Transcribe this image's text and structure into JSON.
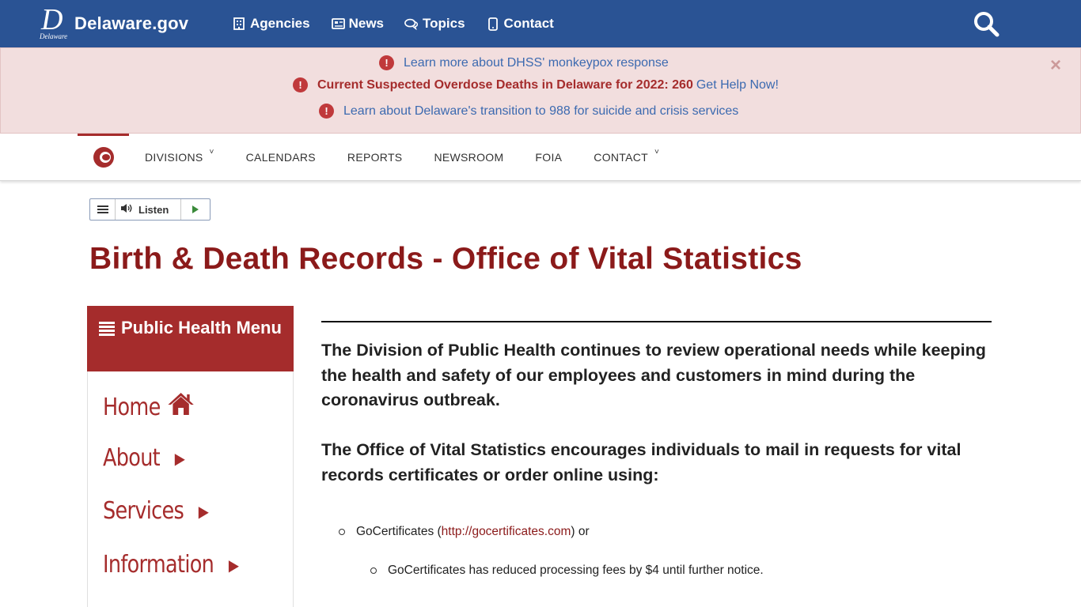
{
  "topbar": {
    "logo_text": "Delaware.gov",
    "logo_letter": "D",
    "logo_sub": "Delaware",
    "nav": [
      {
        "label": "Agencies",
        "icon": "building-icon"
      },
      {
        "label": "News",
        "icon": "newspaper-icon"
      },
      {
        "label": "Topics",
        "icon": "comments-icon"
      },
      {
        "label": "Contact",
        "icon": "phone-icon"
      }
    ],
    "search_icon": "search-icon"
  },
  "alerts": {
    "close_glyph": "×",
    "items": [
      {
        "bold": "",
        "link": "Learn more about DHSS' monkeypox response"
      },
      {
        "bold": "Current Suspected Overdose Deaths in Delaware for 2022: 260",
        "link": "Get Help Now!"
      },
      {
        "bold": "",
        "link": "Learn about Delaware's transition to 988 for suicide and crisis services"
      }
    ]
  },
  "division_nav": {
    "items": [
      {
        "label": "DIVISIONS",
        "has_caret": true
      },
      {
        "label": "CALENDARS",
        "has_caret": false
      },
      {
        "label": "REPORTS",
        "has_caret": false
      },
      {
        "label": "NEWSROOM",
        "has_caret": false
      },
      {
        "label": "FOIA",
        "has_caret": false
      },
      {
        "label": "CONTACT",
        "has_caret": true
      }
    ]
  },
  "listen": {
    "label": "Listen"
  },
  "page_title": "Birth & Death Records - Office of Vital Statistics",
  "side_menu": {
    "heading": "Public Health Menu",
    "items": [
      {
        "label": "Home",
        "icon": "home-icon"
      },
      {
        "label": "About",
        "icon": "caret-right-icon"
      },
      {
        "label": "Services",
        "icon": "caret-right-icon"
      },
      {
        "label": "Information",
        "icon": "caret-right-icon"
      }
    ]
  },
  "content": {
    "para1": "The Division of Public Health continues to review operational needs while keeping the health and safety of our employees and customers in mind during the coronavirus outbreak.",
    "para2": "The Office of Vital Statistics encourages individuals to mail in requests for vital records certificates or order online using:",
    "bullet1_pre": "GoCertificates (",
    "bullet1_link": "http://gocertificates.com",
    "bullet1_post": ") or",
    "bullet2": "GoCertificates has reduced processing fees by $4 until further notice."
  },
  "colors": {
    "topbar": "#2a5394",
    "brand_red": "#a52c2c",
    "title_red": "#8b1a1a",
    "alert_bg": "#f2dede"
  }
}
